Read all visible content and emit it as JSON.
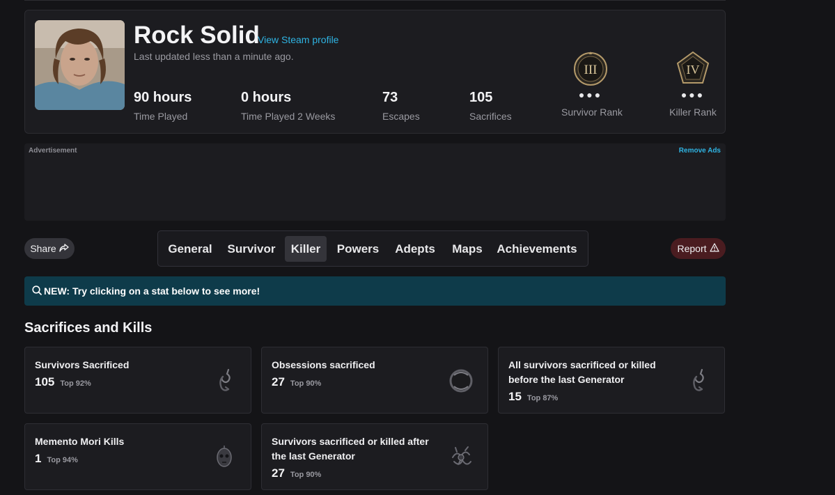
{
  "profile": {
    "name": "Rock Solid",
    "steam_link": "View Steam profile",
    "updated": "Last updated less than a minute ago.",
    "stats": [
      {
        "value": "90 hours",
        "label": "Time Played"
      },
      {
        "value": "0 hours",
        "label": "Time Played 2 Weeks"
      },
      {
        "value": "73",
        "label": "Escapes"
      },
      {
        "value": "105",
        "label": "Sacrifices"
      }
    ],
    "survivor_rank": {
      "numeral": "III",
      "dots": "●●●",
      "label": "Survivor Rank"
    },
    "killer_rank": {
      "numeral": "IV",
      "dots": "●●●",
      "label": "Killer Rank"
    }
  },
  "ad": {
    "label": "Advertisement",
    "remove": "Remove Ads"
  },
  "share": {
    "label": "Share",
    "icon": "share-arrow-icon"
  },
  "report": {
    "label": "Report",
    "icon": "warning-triangle-icon"
  },
  "tabs": [
    {
      "label": "General"
    },
    {
      "label": "Survivor"
    },
    {
      "label": "Killer",
      "active": true
    },
    {
      "label": "Powers"
    },
    {
      "label": "Adepts"
    },
    {
      "label": "Maps"
    },
    {
      "label": "Achievements"
    }
  ],
  "banner": {
    "text": "NEW: Try clicking on a stat below to see more!",
    "icon": "search-icon"
  },
  "section": {
    "title": "Sacrifices and Kills"
  },
  "cards": [
    {
      "title": "Survivors Sacrificed",
      "value": "105",
      "top": "Top 92%",
      "icon": "hook-icon"
    },
    {
      "title": "Obsessions sacrificed",
      "value": "27",
      "top": "Top 90%",
      "icon": "obsession-icon"
    },
    {
      "title": "All survivors sacrificed or killed before the last Generator",
      "value": "15",
      "top": "Top 87%",
      "icon": "hook-icon"
    },
    {
      "title": "Memento Mori Kills",
      "value": "1",
      "top": "Top 94%",
      "icon": "skull-icon"
    },
    {
      "title": "Survivors sacrificed or killed after the last Generator",
      "value": "27",
      "top": "Top 90%",
      "icon": "entity-icon"
    }
  ],
  "colors": {
    "accent": "#2fb4e3",
    "banner": "#0e3b4a",
    "report": "#4a1c20",
    "card": "#1c1c20",
    "background": "#141417"
  }
}
